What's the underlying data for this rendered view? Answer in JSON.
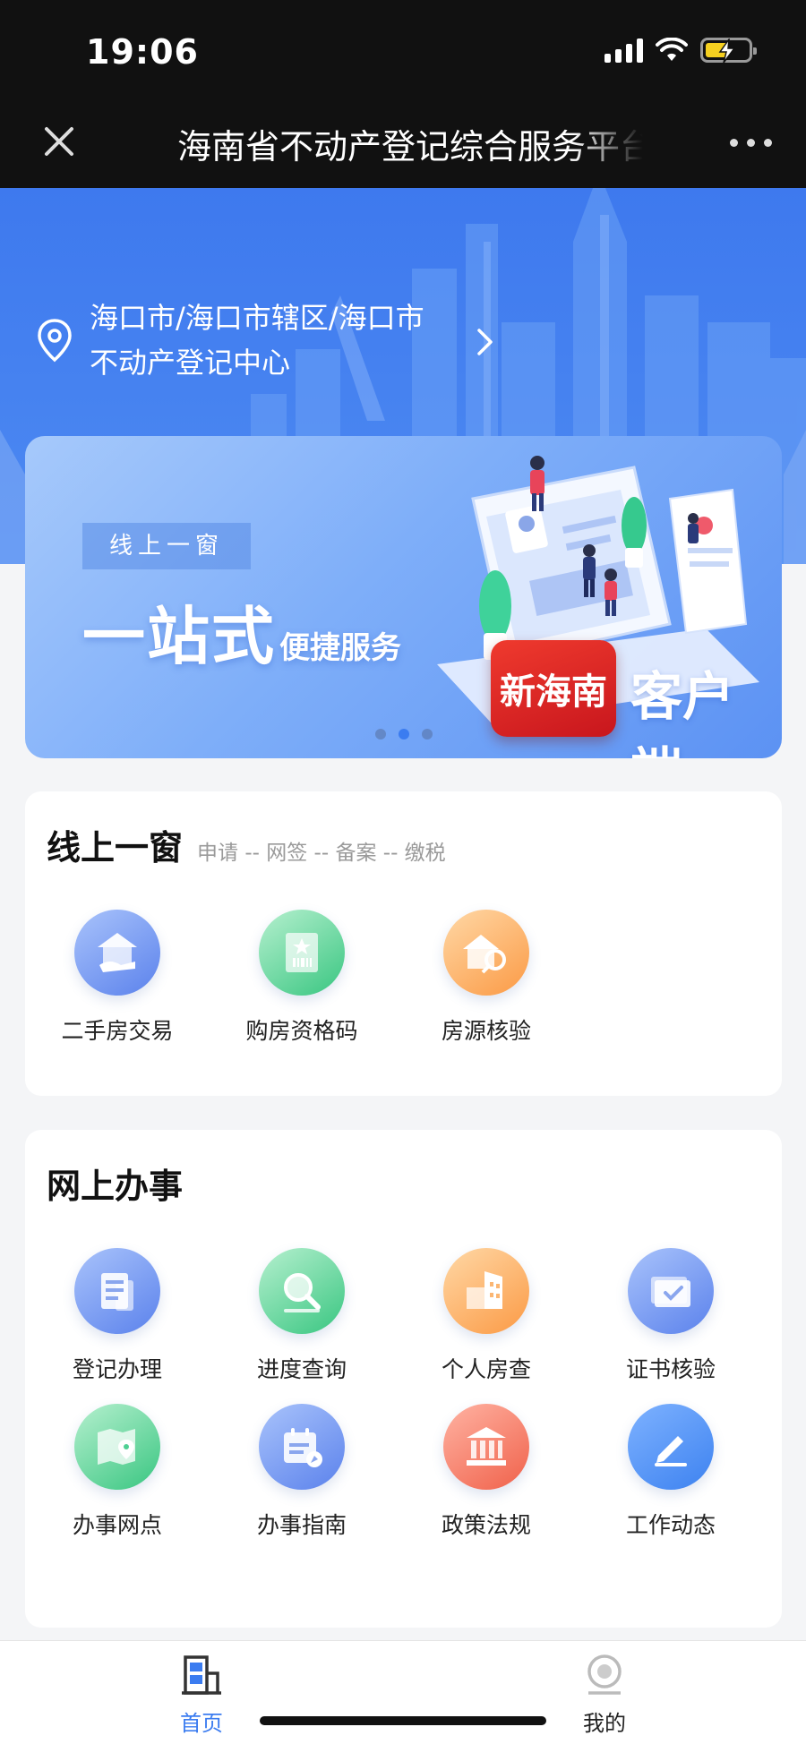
{
  "status_bar": {
    "time": "19:06"
  },
  "nav": {
    "title": "海南省不动产登记综合服务平台"
  },
  "location": {
    "line1": "海口市/海口市辖区/海口市",
    "line2": "不动产登记中心"
  },
  "banner": {
    "tag": "线上一窗",
    "headline_big": "一站式",
    "headline_small": "便捷服务",
    "app_logo_text": "新海南",
    "client_label": "客户端",
    "dots": 3,
    "active_dot": 2
  },
  "online_window": {
    "title": "线上一窗",
    "subtitle": "申请 -- 网签 -- 备案 -- 缴税",
    "items": [
      {
        "label": "二手房交易",
        "icon": "house-hand-icon"
      },
      {
        "label": "购房资格码",
        "icon": "qualification-code-icon"
      },
      {
        "label": "房源核验",
        "icon": "house-key-icon"
      }
    ]
  },
  "online_services": {
    "title": "网上办事",
    "items": [
      {
        "label": "登记办理",
        "icon": "document-register-icon"
      },
      {
        "label": "进度查询",
        "icon": "magnifier-icon"
      },
      {
        "label": "个人房查",
        "icon": "building-icon"
      },
      {
        "label": "证书核验",
        "icon": "certificate-check-icon"
      },
      {
        "label": "办事网点",
        "icon": "map-pin-icon"
      },
      {
        "label": "办事指南",
        "icon": "calendar-guide-icon"
      },
      {
        "label": "政策法规",
        "icon": "courthouse-icon"
      },
      {
        "label": "工作动态",
        "icon": "pencil-edit-icon"
      }
    ]
  },
  "tab_bar": {
    "home": "首页",
    "mine": "我的"
  },
  "colors": {
    "accent": "#3b7cf0",
    "hero": "#4a86f0"
  }
}
